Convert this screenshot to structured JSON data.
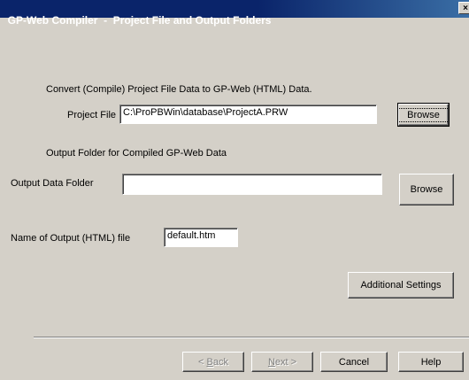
{
  "window": {
    "title": "GP-Web Compiler  -  Project File and Output Folders",
    "close_glyph": "×"
  },
  "convert": {
    "heading": "Convert (Compile) Project File Data to GP-Web (HTML) Data.",
    "project_file_label": "Project File",
    "project_file_value": "C:\\ProPBWin\\database\\ProjectA.PRW",
    "browse_label": "Browse"
  },
  "output": {
    "heading": "Output Folder for Compiled GP-Web Data",
    "folder_label": "Output Data Folder",
    "folder_value": "",
    "browse_label": "Browse"
  },
  "html_file": {
    "label": "Name of Output (HTML) file",
    "value": "default.htm"
  },
  "additional_settings_label": "Additional Settings",
  "footer": {
    "back_prefix": "< ",
    "back_mnemonic": "B",
    "back_rest": "ack",
    "next_mnemonic": "N",
    "next_rest": "ext >",
    "cancel_label": "Cancel",
    "help_label": "Help"
  },
  "icons": {
    "close": "close-icon"
  },
  "colors": {
    "titlebar": "#0a246a",
    "face": "#d4d0c8"
  }
}
